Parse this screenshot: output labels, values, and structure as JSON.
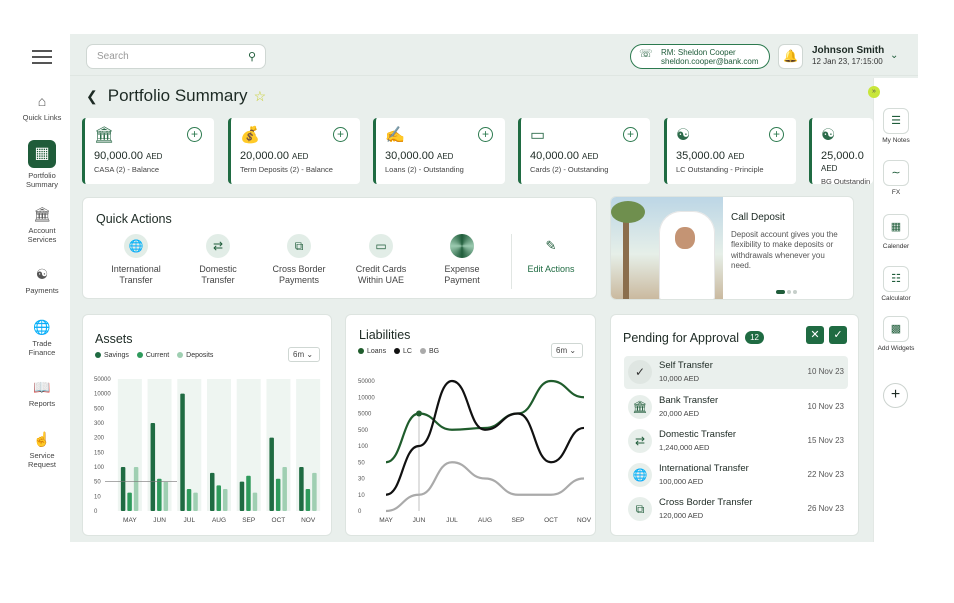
{
  "nav": {
    "items": [
      {
        "label": "Quick Links",
        "icon": "home-icon"
      },
      {
        "label": "Portfolio Summary",
        "icon": "grid-icon",
        "active": true
      },
      {
        "label": "Account Services",
        "icon": "bank-icon"
      },
      {
        "label": "Payments",
        "icon": "hand-coin-icon"
      },
      {
        "label": "Trade Finance",
        "icon": "globe-icon"
      },
      {
        "label": "Reports",
        "icon": "book-icon"
      },
      {
        "label": "Service Request",
        "icon": "touch-icon"
      }
    ]
  },
  "header": {
    "search_placeholder": "Search",
    "rm_line1": "RM: Sheldon Cooper",
    "rm_line2": "sheldon.cooper@bank.com",
    "user_name": "Johnson Smith",
    "user_datetime": "12 Jan 23, 17:15:00"
  },
  "page": {
    "title": "Portfolio Summary"
  },
  "cards": [
    {
      "amount": "90,000.00",
      "currency": "AED",
      "label": "CASA (2) - Balance",
      "icon": "bank-icon"
    },
    {
      "amount": "20,000.00",
      "currency": "AED",
      "label": "Term Deposits (2) - Balance",
      "icon": "money-bag-icon"
    },
    {
      "amount": "30,000.00",
      "currency": "AED",
      "label": "Loans (2) - Outstanding",
      "icon": "hand-money-icon"
    },
    {
      "amount": "40,000.00",
      "currency": "AED",
      "label": "Cards (2) - Outstanding",
      "icon": "card-icon"
    },
    {
      "amount": "35,000.00",
      "currency": "AED",
      "label": "LC Outstanding - Principle",
      "icon": "hand-coin-icon"
    },
    {
      "amount": "25,000.0",
      "currency": "AED",
      "label": "BG Outstandin",
      "icon": "hand-coin-icon"
    }
  ],
  "quick_actions": {
    "title": "Quick Actions",
    "items": [
      {
        "l1": "International",
        "l2": "Transfer",
        "icon": "globe-icon"
      },
      {
        "l1": "Domestic",
        "l2": "Transfer",
        "icon": "bank-transfer-icon"
      },
      {
        "l1": "Cross Border",
        "l2": "Payments",
        "icon": "cross-border-icon"
      },
      {
        "l1": "Credit Cards",
        "l2": "Within UAE",
        "icon": "card-icon"
      },
      {
        "l1": "Expense",
        "l2": "Payment",
        "icon": "expense-icon"
      }
    ],
    "edit_label": "Edit Actions"
  },
  "promo": {
    "title": "Call Deposit",
    "body": "Deposit account gives you the flexibility to make deposits or withdrawals whenever you need."
  },
  "assets": {
    "title": "Assets",
    "range": "6m",
    "legend": [
      "Savings",
      "Current",
      "Deposits"
    ],
    "colors": [
      "#1f6b42",
      "#2f9a5c",
      "#9fcfb2"
    ]
  },
  "liabilities": {
    "title": "Liabilities",
    "range": "6m",
    "legend": [
      "Loans",
      "LC",
      "BG"
    ],
    "colors": [
      "#1f5c2c",
      "#111111",
      "#aaaaaa"
    ]
  },
  "pending": {
    "title": "Pending for Approval",
    "count": "12",
    "rows": [
      {
        "name": "Self Transfer",
        "amount": "10,000 AED",
        "date": "10 Nov 23",
        "icon": "check-icon"
      },
      {
        "name": "Bank Transfer",
        "amount": "20,000 AED",
        "date": "10 Nov 23",
        "icon": "bank-icon"
      },
      {
        "name": "Domestic Transfer",
        "amount": "1,240,000 AED",
        "date": "15 Nov 23",
        "icon": "bank-transfer-icon"
      },
      {
        "name": "International Transfer",
        "amount": "100,000 AED",
        "date": "22 Nov 23",
        "icon": "globe-icon"
      },
      {
        "name": "Cross Border Transfer",
        "amount": "120,000 AED",
        "date": "26 Nov 23",
        "icon": "cross-border-icon"
      }
    ]
  },
  "right_widgets": [
    {
      "label": "My Notes",
      "icon": "notes-icon"
    },
    {
      "label": "FX",
      "icon": "fx-icon"
    },
    {
      "label": "Calender",
      "icon": "calendar-icon"
    },
    {
      "label": "Calculator",
      "icon": "calculator-icon"
    },
    {
      "label": "Add Widgets",
      "icon": "widgets-icon"
    }
  ],
  "chart_data": [
    {
      "type": "bar",
      "title": "Assets",
      "categories": [
        "MAY",
        "JUN",
        "JUL",
        "AUG",
        "SEP",
        "OCT",
        "NOV"
      ],
      "y_ticks": [
        "50000",
        "10000",
        "500",
        "300",
        "200",
        "150",
        "100",
        "50",
        "10",
        "0"
      ],
      "series": [
        {
          "name": "Savings",
          "values": [
            100,
            300,
            10000,
            80,
            50,
            200,
            100
          ]
        },
        {
          "name": "Current",
          "values": [
            20,
            60,
            30,
            40,
            70,
            60,
            30
          ]
        },
        {
          "name": "Deposits",
          "values": [
            100,
            50,
            20,
            30,
            20,
            100,
            80
          ]
        }
      ]
    },
    {
      "type": "line",
      "title": "Liabilities",
      "categories": [
        "MAY",
        "JUN",
        "JUL",
        "AUG",
        "SEP",
        "OCT",
        "NOV"
      ],
      "y_ticks": [
        "50000",
        "10000",
        "5000",
        "500",
        "100",
        "50",
        "30",
        "10",
        "0"
      ],
      "series": [
        {
          "name": "Loans",
          "values": [
            50,
            5000,
            500,
            1000,
            5000,
            50000,
            10000
          ]
        },
        {
          "name": "LC",
          "values": [
            10,
            100,
            50000,
            500,
            5000,
            50,
            1000
          ]
        },
        {
          "name": "BG",
          "values": [
            0,
            10,
            50,
            30,
            10,
            10,
            30
          ]
        }
      ]
    }
  ]
}
